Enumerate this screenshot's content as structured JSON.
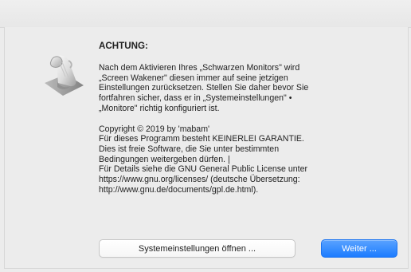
{
  "dialog": {
    "heading": "ACHTUNG:",
    "paragraph_1": "Nach dem Aktivieren Ihres „Schwarzen Monitors\" wird\n„Screen Wakener\" diesen immer auf seine jetzigen\nEinstellungen zurücksetzen. Stellen Sie daher bevor Sie\nfortfahren sicher, dass er in „Systemeinstellungen\" •\n„Monitore\" richtig konfiguriert ist.",
    "paragraph_2": "Copyright © 2019 by 'mabam'\nFür dieses Programm besteht KEINERLEI GARANTIE.\nDies ist freie Software, die Sie unter bestimmten\nBedingungen weitergeben dürfen. |\nFür Details siehe die GNU General Public License unter\nhttps://www.gnu.org/licenses/ (deutsche Übersetzung:\nhttp://www.gnu.de/documents/gpl.de.html).",
    "buttons": {
      "open_settings_label": "Systemeinstellungen öffnen ...",
      "continue_label": "Weiter ..."
    },
    "icon": {
      "name": "script-icon"
    }
  },
  "colors": {
    "window_bg": "#ececec",
    "primary_button_top": "#5aa3ff",
    "primary_button_bottom": "#1c7cff",
    "secondary_button_border": "#c6c6c6"
  }
}
